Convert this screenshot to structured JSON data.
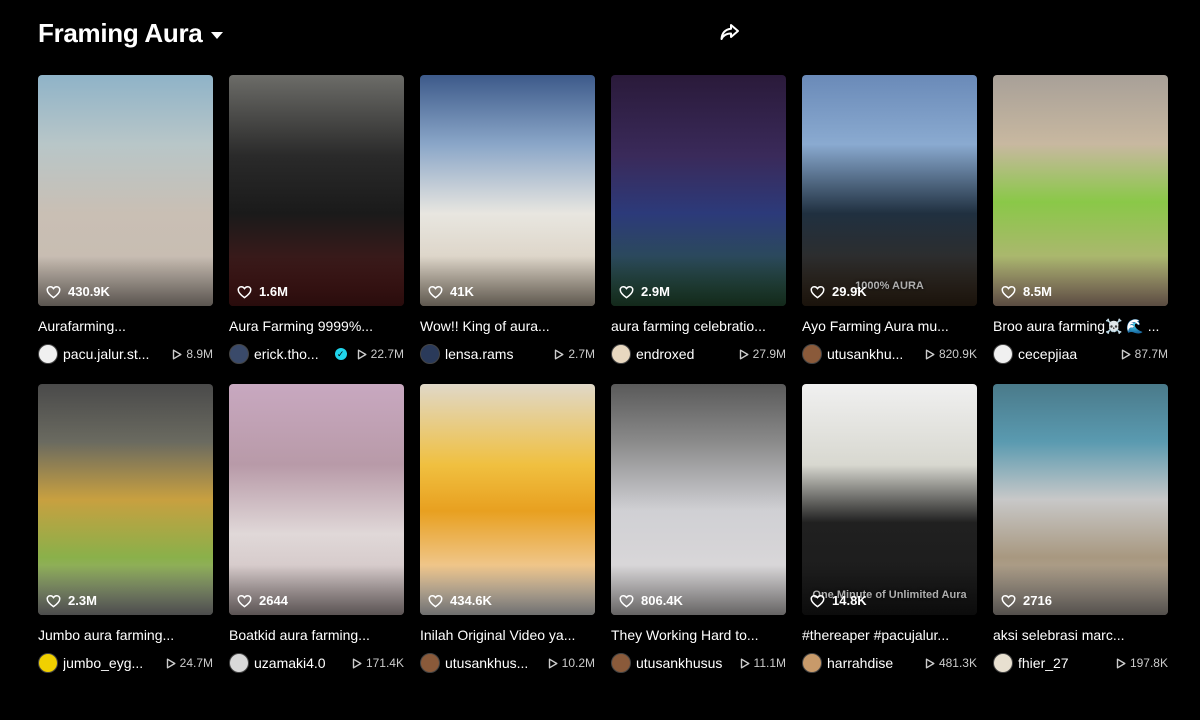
{
  "header": {
    "title": "Framing Aura"
  },
  "videos": [
    {
      "caption": "Aurafarming...",
      "likes": "430.9K",
      "author": "pacu.jalur.st...",
      "views": "8.9M",
      "verified": false,
      "bg": "linear-gradient(180deg,#8fb3c8 0%,#b8c6c8 30%,#c9bfb4 60%,#c7bbb0 100%)",
      "avatar": "#f0f0f0"
    },
    {
      "caption": "Aura Farming 9999%...",
      "likes": "1.6M",
      "author": "erick.tho...",
      "views": "22.7M",
      "verified": true,
      "bg": "linear-gradient(180deg,#6c6c68 0%,#2a2a2a 35%,#1a1a1a 60%,#5a1a1a 100%)",
      "avatar": "#3a4a6a"
    },
    {
      "caption": "Wow!! King of aura...",
      "likes": "41K",
      "author": "lensa.rams",
      "views": "2.7M",
      "verified": false,
      "bg": "linear-gradient(180deg,#3d5a8a 0%,#8aa6c8 30%,#e8e6e0 60%,#d2c4b0 100%)",
      "avatar": "#2a3a5a"
    },
    {
      "caption": "aura farming celebratio...",
      "likes": "2.9M",
      "author": "endroxed",
      "views": "27.9M",
      "verified": false,
      "bg": "linear-gradient(180deg,#2a1a3a 0%,#3a2a5a 35%,#2c3a7a 60%,#2a5a3a 100%)",
      "avatar": "#e8d8c0"
    },
    {
      "caption": "Ayo Farming Aura mu...",
      "likes": "29.9K",
      "author": "utusankhu...",
      "views": "820.9K",
      "verified": false,
      "bg": "linear-gradient(180deg,#6a8ab8 0%,#8aaad0 30%,#203040 60%,#3a2a1a 100%)",
      "avatar": "#8a5a3a",
      "overlay_text": "1000% AURA"
    },
    {
      "caption": "Broo aura farming☠️ 🌊 ...",
      "likes": "8.5M",
      "author": "cecepjiaa",
      "views": "87.7M",
      "verified": false,
      "bg": "linear-gradient(180deg,#a8a098 0%,#c8b8a0 30%,#8ac848 55%,#c8a890 100%)",
      "avatar": "#f0f0f0"
    },
    {
      "caption": "Jumbo aura farming...",
      "likes": "2.3M",
      "author": "jumbo_eyg...",
      "views": "24.7M",
      "verified": false,
      "bg": "linear-gradient(180deg,#4a4a4a 0%,#6a6a60 25%,#c8a040 50%,#8ab04a 75%,#a8a8a8 100%)",
      "avatar": "#f0d000"
    },
    {
      "caption": "Boatkid aura farming...",
      "likes": "2644",
      "author": "uzamaki4.0",
      "views": "171.4K",
      "verified": false,
      "bg": "linear-gradient(180deg,#c8a8c0 0%,#b89aa8 35%,#e0d8d8 65%,#c8b8b8 100%)",
      "avatar": "#d8d8d8"
    },
    {
      "caption": "Inilah Original Video ya...",
      "likes": "434.6K",
      "author": "utusankhus...",
      "views": "10.2M",
      "verified": false,
      "bg": "linear-gradient(180deg,#e0d8c8 0%,#f0c040 35%,#e8a020 55%,#f0c890 80%,#f4f4f4 100%)",
      "avatar": "#8a5a3a"
    },
    {
      "caption": "They Working Hard to...",
      "likes": "806.4K",
      "author": "utusankhusus",
      "views": "11.1M",
      "verified": false,
      "bg": "linear-gradient(180deg,#5a5a5a 0%,#8a8a8a 25%,#d0d0d4 55%,#e0dcdc 100%)",
      "avatar": "#8a5a3a"
    },
    {
      "caption": "#thereaper #pacujalur...",
      "likes": "14.8K",
      "author": "harrahdise",
      "views": "481.3K",
      "verified": false,
      "bg": "linear-gradient(180deg,#f0f0f0 0%,#d8d8d0 35%,#202020 60%,#1a1a1a 100%)",
      "avatar": "#c89a6a",
      "overlay_text": "One Minute of Unlimited Aura"
    },
    {
      "caption": "aksi selebrasi marc...",
      "likes": "2716",
      "author": "fhier_27",
      "views": "197.8K",
      "verified": false,
      "bg": "linear-gradient(180deg,#4a7a8a 0%,#5a9ab0 25%,#c8c8c8 50%,#a89880 75%,#b8b0a8 100%)",
      "avatar": "#e8e0d0"
    }
  ],
  "icons": {
    "share": "share-icon",
    "heart": "heart-icon",
    "play": "play-icon",
    "caret": "chevron-down-icon",
    "verified": "verified-badge-icon"
  }
}
